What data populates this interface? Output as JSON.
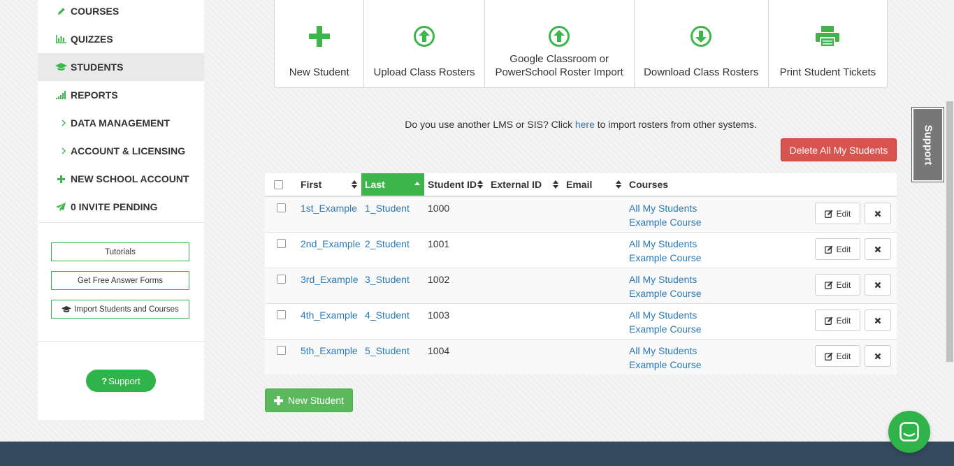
{
  "sidebar": {
    "nav": [
      {
        "label": "COURSES",
        "icon": "pencil-icon"
      },
      {
        "label": "QUIZZES",
        "icon": "bar-chart-icon"
      },
      {
        "label": "STUDENTS",
        "icon": "graduation-cap-icon",
        "active": true
      },
      {
        "label": "REPORTS",
        "icon": "signal-icon"
      },
      {
        "label": "DATA MANAGEMENT",
        "icon": "chevron-right-icon"
      },
      {
        "label": "ACCOUNT & LICENSING",
        "icon": "chevron-right-icon"
      },
      {
        "label": "NEW SCHOOL ACCOUNT",
        "icon": "plus-icon"
      },
      {
        "label": "0 INVITE PENDING",
        "icon": "paper-plane-icon"
      }
    ],
    "buttons": {
      "tutorials": "Tutorials",
      "answer_forms": "Get Free Answer Forms",
      "import": "Import Students and Courses"
    },
    "support": "Support"
  },
  "actions": {
    "new_student": "New Student",
    "upload": "Upload Class Rosters",
    "google_line1": "Google Classroom or",
    "google_line2": "PowerSchool Roster Import",
    "download": "Download Class Rosters",
    "print": "Print Student Tickets"
  },
  "info": {
    "before": "Do you use another LMS or SIS? Click ",
    "link": "here",
    "after": " to import rosters from other systems."
  },
  "delete_all": "Delete All My Students",
  "table": {
    "headers": {
      "first": "First",
      "last": "Last",
      "student_id": "Student ID",
      "external_id": "External ID",
      "email": "Email",
      "courses": "Courses"
    },
    "rows": [
      {
        "first": "1st_Example",
        "last": "1_Student",
        "id": "1000",
        "course1": "All My Students",
        "course2": "Example Course"
      },
      {
        "first": "2nd_Example",
        "last": "2_Student",
        "id": "1001",
        "course1": "All My Students",
        "course2": "Example Course"
      },
      {
        "first": "3rd_Example",
        "last": "3_Student",
        "id": "1002",
        "course1": "All My Students",
        "course2": "Example Course"
      },
      {
        "first": "4th_Example",
        "last": "4_Student",
        "id": "1003",
        "course1": "All My Students",
        "course2": "Example Course"
      },
      {
        "first": "5th_Example",
        "last": "5_Student",
        "id": "1004",
        "course1": "All My Students",
        "course2": "Example Course"
      }
    ],
    "edit_label": "Edit"
  },
  "new_student_button": "New Student",
  "support_tab": "Support",
  "colors": {
    "accent_green": "#3cb64a",
    "danger_red": "#d9534f",
    "link_blue": "#2a7ab7",
    "footer": "#34495e"
  }
}
